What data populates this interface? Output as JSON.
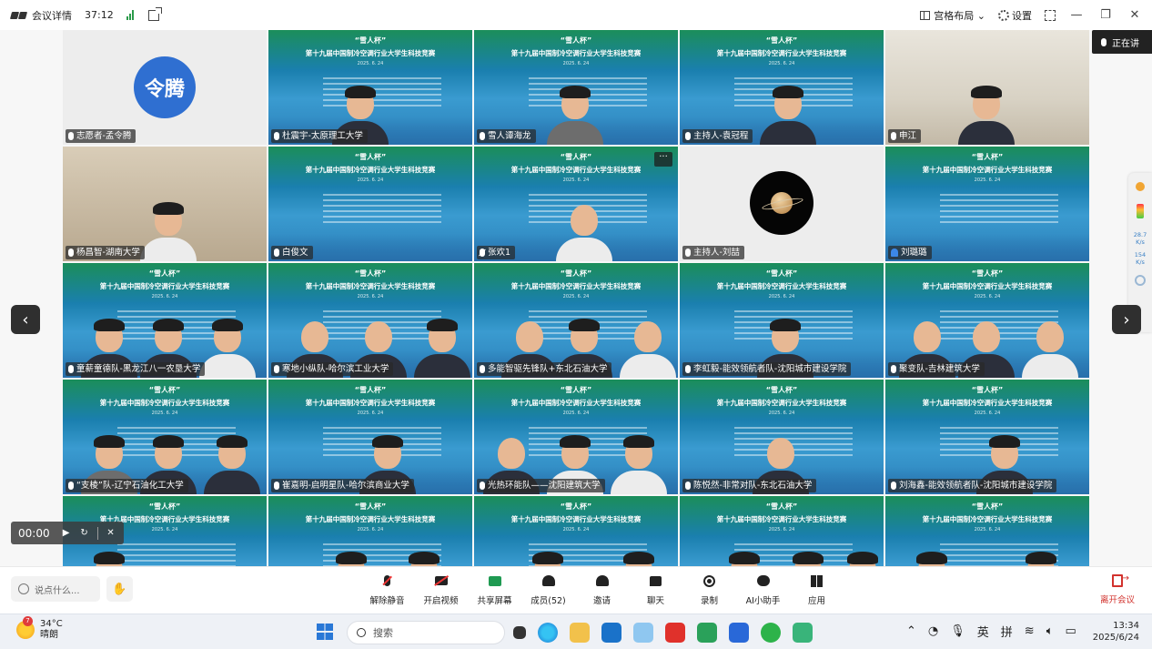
{
  "topbar": {
    "title": "会议详情",
    "duration": "37:12",
    "layout_label": "宫格布局",
    "settings_label": "设置"
  },
  "speaking_label": "正在讲",
  "tiles": [
    {
      "name": "志愿者-孟令腾",
      "avatar": "令腾",
      "kind": "avatar",
      "mic": "on"
    },
    {
      "name": "杜震宇-太原理工大学",
      "kind": "banner",
      "mic": "on"
    },
    {
      "name": "雪人谭海龙",
      "kind": "banner",
      "mic": "on"
    },
    {
      "name": "主持人-袁冠程",
      "kind": "banner",
      "mic": "on"
    },
    {
      "name": "申江",
      "kind": "room",
      "mic": "on"
    },
    {
      "name": "杨昌智-湖南大学",
      "kind": "shelf",
      "mic": "on"
    },
    {
      "name": "白俊文",
      "kind": "banner",
      "mic": "on"
    },
    {
      "name": "张欢1",
      "kind": "banner",
      "mic": "off"
    },
    {
      "name": "主持人-刘喆",
      "kind": "planet",
      "mic": "on"
    },
    {
      "name": "刘璐璐",
      "kind": "banner",
      "mic": "user"
    },
    {
      "name": "童薪童德队-黑龙江八一农垦大学",
      "kind": "banner",
      "mic": "on"
    },
    {
      "name": "寒地小纵队-哈尔滨工业大学",
      "kind": "banner",
      "mic": "on"
    },
    {
      "name": "多能智驱先锋队+东北石油大学",
      "kind": "banner",
      "mic": "on"
    },
    {
      "name": "李虹毅-能效领航者队-沈阳城市建设学院",
      "kind": "banner",
      "mic": "on"
    },
    {
      "name": "聚变队-吉林建筑大学",
      "kind": "banner",
      "mic": "on"
    },
    {
      "name": "“支棱”队-辽宁石油化工大学",
      "kind": "banner",
      "mic": "on"
    },
    {
      "name": "崔嘉明-启明星队-哈尔滨商业大学",
      "kind": "banner",
      "mic": "on"
    },
    {
      "name": "光热环能队——沈阳建筑大学",
      "kind": "banner",
      "mic": "on"
    },
    {
      "name": "陈悦然-非常对队-东北石油大学",
      "kind": "banner",
      "mic": "on"
    },
    {
      "name": "刘海鑫-能效领航者队-沈阳城市建设学院",
      "kind": "banner",
      "mic": "on"
    },
    {
      "name": "",
      "kind": "banner",
      "mic": "none"
    },
    {
      "name": "",
      "kind": "banner",
      "mic": "none"
    },
    {
      "name": "",
      "kind": "banner",
      "mic": "none"
    },
    {
      "name": "",
      "kind": "banner",
      "mic": "none"
    },
    {
      "name": "",
      "kind": "banner",
      "mic": "none"
    }
  ],
  "banner": {
    "line1": "“雪人杯”",
    "line2": "第十九届中国制冷空调行业大学生科技竞赛",
    "line3": "2025. 6. 24"
  },
  "player": {
    "time": "00:00"
  },
  "toolbar": {
    "chat_placeholder": "说点什么...",
    "tools": [
      {
        "label": "解除静音",
        "icon": "mic-muted-icon"
      },
      {
        "label": "开启视频",
        "icon": "camera-off-icon"
      },
      {
        "label": "共享屏幕",
        "icon": "share-screen-icon"
      },
      {
        "label": "成员(52)",
        "icon": "members-icon"
      },
      {
        "label": "邀请",
        "icon": "invite-icon"
      },
      {
        "label": "聊天",
        "icon": "chat-icon"
      },
      {
        "label": "录制",
        "icon": "record-icon"
      },
      {
        "label": "AI小助手",
        "icon": "ai-assistant-icon"
      },
      {
        "label": "应用",
        "icon": "apps-icon"
      }
    ],
    "leave_label": "离开会议"
  },
  "side_panel": {
    "up": "28.7",
    "up_unit": "K/s",
    "down": "154",
    "down_unit": "K/s"
  },
  "taskbar": {
    "badge": "7",
    "temperature": "34°C",
    "weather": "晴朗",
    "search_placeholder": "搜索",
    "ime1": "英",
    "ime2": "拼",
    "time": "13:34",
    "date": "2025/6/24"
  },
  "colors": {
    "accent_blue": "#2f6fd1",
    "leave_red": "#d2322d",
    "banner_green": "#1b8e5a",
    "banner_blue": "#2b7fb9"
  }
}
